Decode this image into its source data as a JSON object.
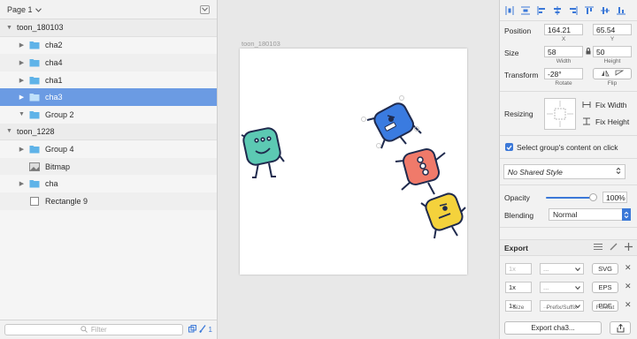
{
  "page_selector": {
    "label": "Page 1",
    "chevron_icon": "chevron-down-icon"
  },
  "layers": [
    {
      "name": "toon_180103",
      "level": 0,
      "type": "artboard",
      "expanded": true
    },
    {
      "name": "cha2",
      "level": 1,
      "type": "folder",
      "expandable": true
    },
    {
      "name": "cha4",
      "level": 1,
      "type": "folder",
      "expandable": true
    },
    {
      "name": "cha1",
      "level": 1,
      "type": "folder",
      "expandable": true
    },
    {
      "name": "cha3",
      "level": 1,
      "type": "folder",
      "expandable": true,
      "selected": true
    },
    {
      "name": "Group 2",
      "level": 1,
      "type": "folder",
      "expandable": true,
      "expanded": true
    },
    {
      "name": "toon_1228",
      "level": 0,
      "type": "artboard",
      "expanded": true
    },
    {
      "name": "Group 4",
      "level": 1,
      "type": "folder",
      "expandable": true
    },
    {
      "name": "Bitmap",
      "level": 1,
      "type": "bitmap",
      "expandable": false
    },
    {
      "name": "cha",
      "level": 1,
      "type": "folder",
      "expandable": true
    },
    {
      "name": "Rectangle 9",
      "level": 1,
      "type": "rectangle",
      "expandable": false
    }
  ],
  "footer": {
    "filter_placeholder": "Filter",
    "badge_count": "1"
  },
  "canvas": {
    "artboard_name": "toon_180103"
  },
  "characters": [
    {
      "name": "cha2",
      "color": "#5cc9b3"
    },
    {
      "name": "cha3",
      "color": "#3a7be0"
    },
    {
      "name": "cha4",
      "color": "#f07a6a"
    },
    {
      "name": "cha1",
      "color": "#f4d23c"
    }
  ],
  "inspector": {
    "position": {
      "label": "Position",
      "x": "164.21",
      "y": "65.54",
      "x_label": "X",
      "y_label": "Y"
    },
    "size": {
      "label": "Size",
      "width": "58",
      "height": "50",
      "width_label": "Width",
      "height_label": "Height"
    },
    "transform": {
      "label": "Transform",
      "rotate": "-28°",
      "rotate_label": "Rotate",
      "flip_label": "Flip"
    },
    "resizing": {
      "label": "Resizing",
      "fix_width": "Fix Width",
      "fix_height": "Fix Height"
    },
    "select_group": {
      "label": "Select group's content on click",
      "checked": true
    },
    "shared_style": {
      "label": "No Shared Style"
    },
    "opacity": {
      "label": "Opacity",
      "value": "100%",
      "fraction": 1.0
    },
    "blending": {
      "label": "Blending",
      "value": "Normal"
    },
    "accent": "#3b78d8",
    "export": {
      "title": "Export",
      "rows": [
        {
          "size": "1x",
          "format": "SVG",
          "dim": true
        },
        {
          "size": "1x",
          "format": "EPS",
          "dim": false
        },
        {
          "size": "1x",
          "format": "PDF",
          "dim": false
        }
      ],
      "prefix_placeholder": "...",
      "col_size": "Size",
      "col_prefix": "Prefix/Suffix",
      "col_format": "Format",
      "export_button": "Export cha3..."
    }
  }
}
